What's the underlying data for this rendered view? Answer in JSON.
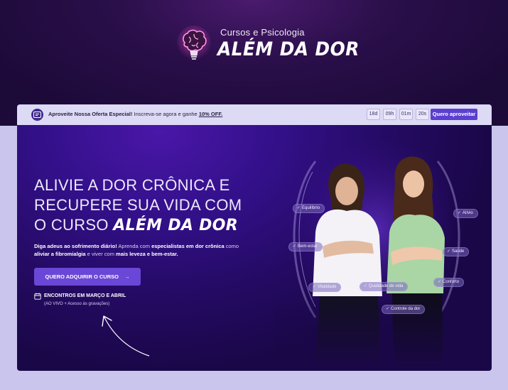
{
  "header": {
    "logo_subtitle": "Cursos e Psicologia",
    "logo_title": "ALÉM DA DOR",
    "logo_icon": "brain-bulb-icon"
  },
  "offer_bar": {
    "highlight": "Aproveite Nossa Oferta Especial!",
    "text": "Inscreva-se agora e ganhe",
    "discount": "10% OFF.",
    "countdown": [
      "18d",
      "09h",
      "01m",
      "20s"
    ],
    "button_label": "Quero aproveitar"
  },
  "hero": {
    "headline_line1": "ALIVIE A DOR CRÔNICA E",
    "headline_line2": "RECUPERE SUA VIDA COM",
    "headline_line3": "O CURSO",
    "headline_brand": "ALÉM DA DOR",
    "desc_1": "Diga adeus ao sofrimento diário!",
    "desc_2": " Aprenda com ",
    "desc_3": "especialistas em dor crônica",
    "desc_4": " como ",
    "desc_5": "aliviar a fibromialgia",
    "desc_6": " e viver com ",
    "desc_7": "mais leveza e bem-estar.",
    "cta_label": "QUERO ADQUIRIR O CURSO",
    "cta_arrow": "→",
    "meetings_title": "ENCONTROS EM MARÇO E ABRIL",
    "meetings_sub": "(AO VIVO + Acesso às gravações)"
  },
  "tags": {
    "equilibrio": "Equilíbrio",
    "alivio": "Alívio",
    "bem_estar": "Bem-estar",
    "saude": "Saúde",
    "conforto": "Conforto",
    "vitalidade": "Vitalidade",
    "qualidade": "Qualidade de vida",
    "controle": "Controle da dor"
  },
  "colors": {
    "accent": "#6a47d6",
    "background": "#c9c5ec",
    "hero_bg": "#2a0c70"
  }
}
